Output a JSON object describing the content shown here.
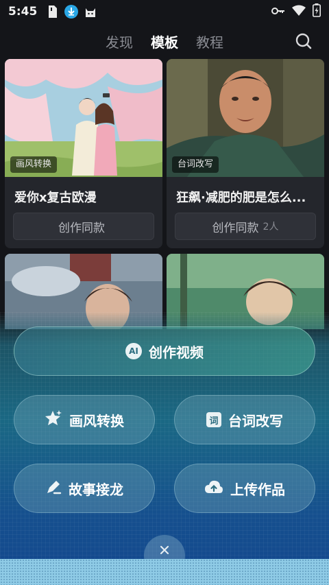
{
  "status_bar": {
    "time": "5:45",
    "left_icons": [
      "sim-card-icon",
      "download-icon",
      "cat-app-icon"
    ],
    "right_icons": [
      "key-icon",
      "wifi-icon",
      "battery-icon"
    ]
  },
  "top_tabs": [
    {
      "label": "发现",
      "active": false
    },
    {
      "label": "模板",
      "active": true
    },
    {
      "label": "教程",
      "active": false
    }
  ],
  "cards": [
    {
      "tag": "画风转换",
      "title": "爱你x复古欧漫",
      "button": "创作同款",
      "count": ""
    },
    {
      "tag": "台词改写",
      "title": "狂飙·减肥的肥是怎么...",
      "button": "创作同款",
      "count": "2人"
    }
  ],
  "actions": {
    "main": {
      "badge": "AI",
      "label": "创作视频"
    },
    "style_convert": {
      "label": "画风转换",
      "icon": "sparkle-star-icon"
    },
    "line_rewrite": {
      "badge": "词",
      "label": "台词改写"
    },
    "story_relay": {
      "label": "故事接龙",
      "icon": "pen-icon"
    },
    "upload": {
      "label": "上传作品",
      "icon": "cloud-upload-icon"
    }
  },
  "colors": {
    "background": "#141519",
    "card": "#24262c",
    "panel_top": "#1a6884",
    "panel_bottom": "#13478f"
  }
}
